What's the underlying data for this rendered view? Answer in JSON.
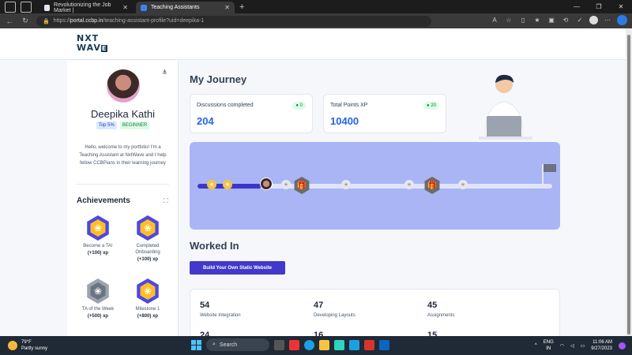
{
  "browser": {
    "tabs": [
      {
        "title": "Revolutionizing the Job Market |",
        "active": false
      },
      {
        "title": "Teaching Assistants",
        "active": true
      }
    ],
    "url_scheme": "https://",
    "url_host": "portal.ccbp.in",
    "url_path": "/teaching-assistant-profile?uid=deepika-1",
    "new_tab": "+",
    "close": "✕",
    "window_controls": [
      "—",
      "❐",
      "✕"
    ]
  },
  "logo": {
    "line1": "NXT",
    "line2": "WAV",
    "line2_box": "E"
  },
  "profile": {
    "name": "Deepika Kathi",
    "rank_badge": "Top 5%",
    "level_badge": "BEGINNER",
    "bio": "Hello, welcome to my portfolio! I'm a Teaching Assistant at NxtWave and I help fellow CCBPians in their learning journey"
  },
  "achievements": {
    "title": "Achievements",
    "items": [
      {
        "label": "Become a TA!",
        "xp": "(+100) xp",
        "locked": false
      },
      {
        "label": "Completed Onboarding",
        "xp": "(+100) xp",
        "locked": false
      },
      {
        "label": "TA of the Week",
        "xp": "(+500) xp",
        "locked": true
      },
      {
        "label": "Milestone 1",
        "xp": "(+800) xp",
        "locked": false
      }
    ]
  },
  "journey": {
    "title": "My Journey",
    "cards": [
      {
        "title": "Discussions completed",
        "value": "204",
        "delta": "0"
      },
      {
        "title": "Total Points XP",
        "value": "10400",
        "delta": "20"
      }
    ],
    "progress": 0.18
  },
  "worked": {
    "title": "Worked In",
    "project_button": "Build Your Own Static Website",
    "stats": [
      {
        "value": "54",
        "label": "Website Integration"
      },
      {
        "value": "47",
        "label": "Developing Layouts"
      },
      {
        "value": "45",
        "label": "Assignments"
      },
      {
        "value": "24",
        "label": ""
      },
      {
        "value": "16",
        "label": ""
      },
      {
        "value": "15",
        "label": ""
      }
    ]
  },
  "taskbar": {
    "temp": "79°F",
    "weather": "Partly sunny",
    "search": "Search",
    "lang1": "ENG",
    "lang2": "IN",
    "time": "11:06 AM",
    "date": "9/27/2023"
  },
  "colors": {
    "accent": "#4338ca",
    "journey_bg": "#a9b5f4",
    "value_blue": "#2563eb"
  }
}
